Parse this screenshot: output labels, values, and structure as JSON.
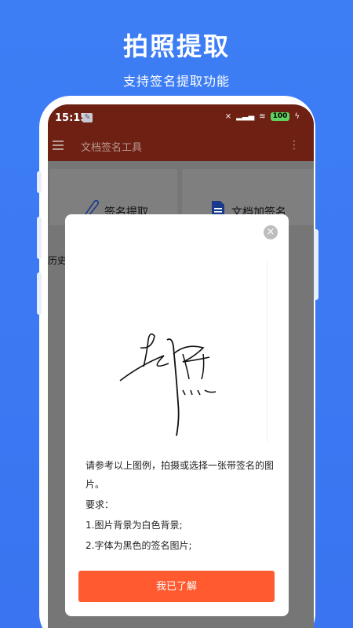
{
  "promo": {
    "title": "拍照提取",
    "subtitle": "支持签名提取功能"
  },
  "status_bar": {
    "time": "15:15",
    "battery": "100"
  },
  "app_bar": {
    "title": "文档签名工具"
  },
  "cards": [
    {
      "label": "签名提取",
      "icon": "pen-icon"
    },
    {
      "label": "文档加签名",
      "icon": "document-icon"
    }
  ],
  "history": {
    "label": "历史"
  },
  "dialog": {
    "instruction_main": "请参考以上图例，拍摄或选择一张带签名的图片。",
    "requirements_title": "要求：",
    "requirement_1": "1.图片背景为白色背景;",
    "requirement_2": "2.字体为黑色的签名图片;",
    "confirm_label": "我已了解"
  },
  "colors": {
    "background": "#3d7ef5",
    "app_bar": "#6e2013",
    "confirm": "#ff5a30"
  }
}
